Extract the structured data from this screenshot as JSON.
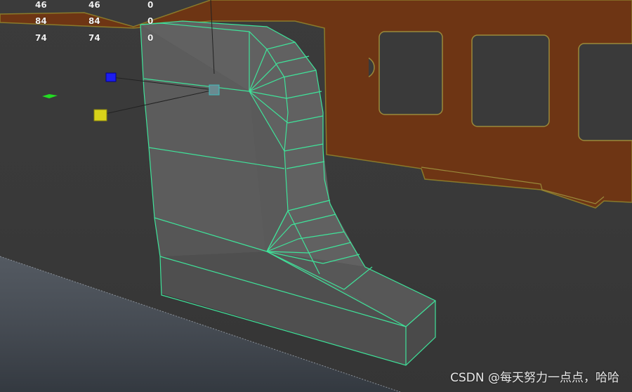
{
  "hud": {
    "rows": [
      [
        "46",
        "46",
        "0"
      ],
      [
        "84",
        "84",
        "0"
      ],
      [
        "74",
        "74",
        "0"
      ]
    ]
  },
  "watermark": "CSDN @每天努力一点点，哈哈",
  "colors": {
    "viewport_bg": "#3a3a3a",
    "wireframe": "#3fe39a",
    "mesh_face": "#585858",
    "backdrop_rust": "#6e3514",
    "gizmo_blue": "#1d1df0",
    "gizmo_yellow": "#d8d21a",
    "gizmo_green": "#22dd22"
  },
  "icons": [
    "manipulator-pivot-icon",
    "manipulator-blue-handle-icon",
    "manipulator-yellow-handle-icon",
    "manipulator-green-handle-icon"
  ]
}
